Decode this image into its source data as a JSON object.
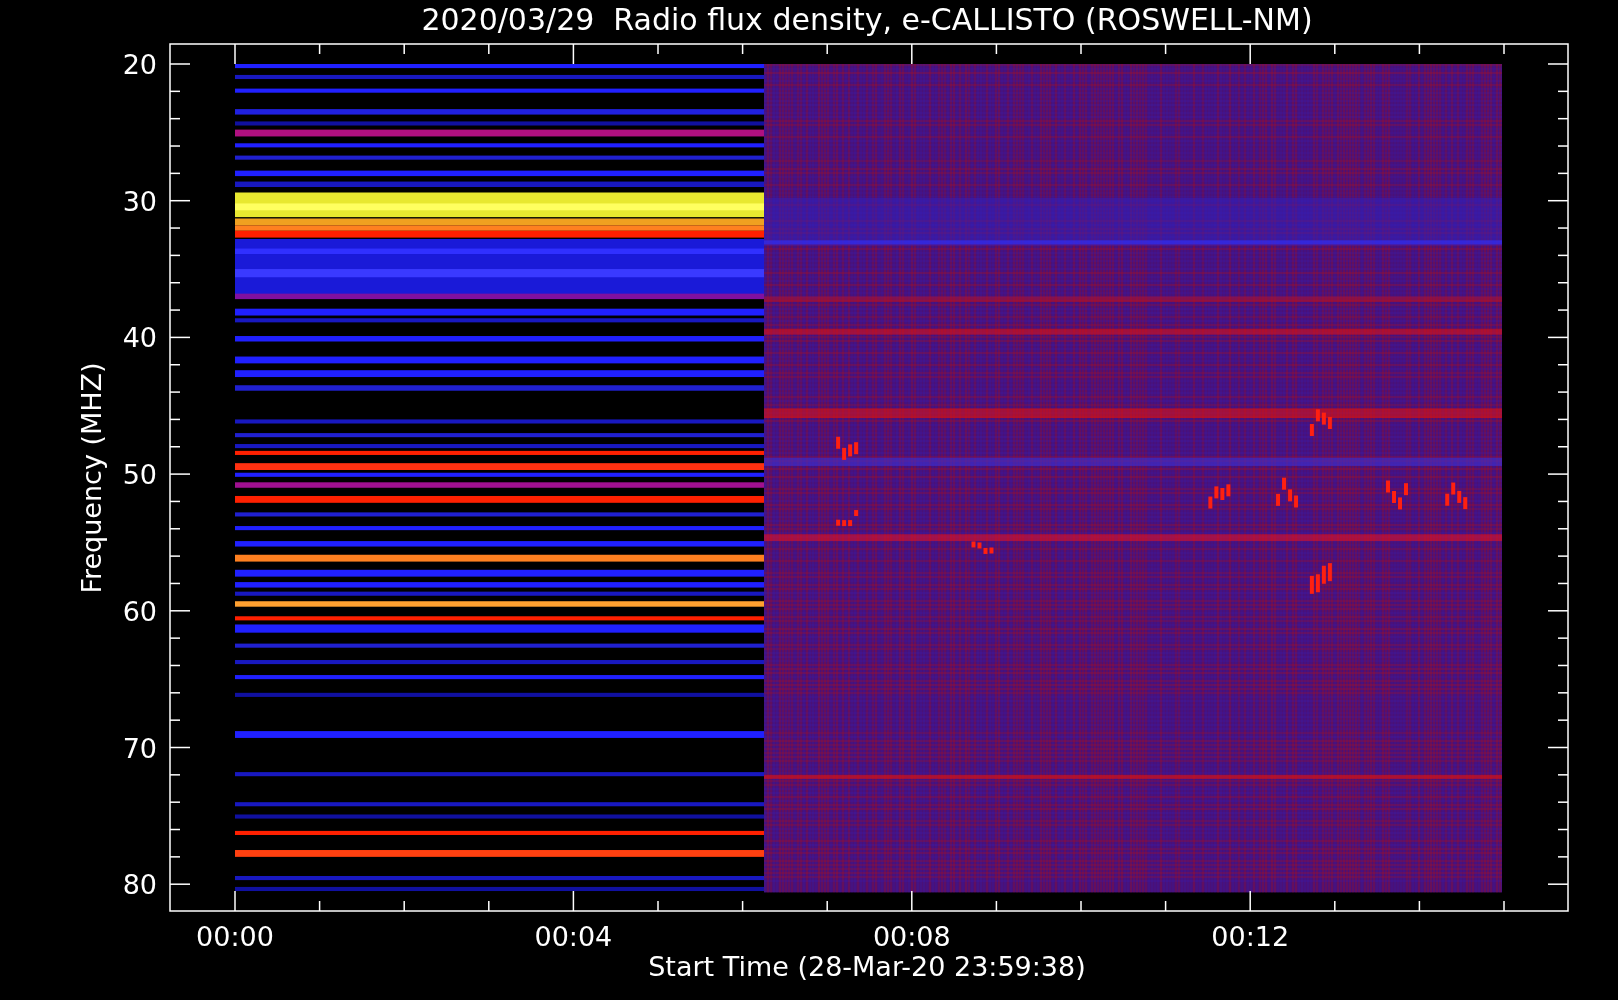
{
  "title": "2020/03/29  Radio flux density, e-CALLISTO (ROSWELL-NM)",
  "ylabel": "Frequency (MHZ)",
  "yticks": [
    "20",
    "30",
    "40",
    "50",
    "60",
    "70",
    "80"
  ],
  "xticks": [
    "00:00",
    "00:04",
    "00:08",
    "00:12"
  ],
  "xlabel": "Start Time (28-Mar-20 23:59:38)"
}
